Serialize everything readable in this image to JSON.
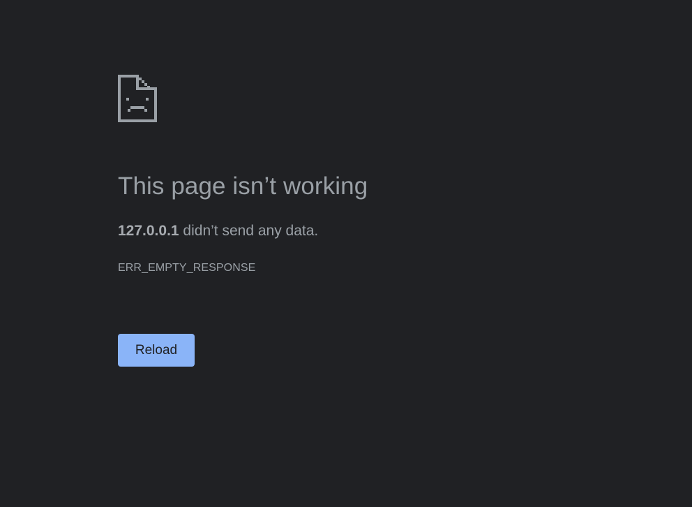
{
  "error_page": {
    "icon": "sad-file-icon",
    "heading": "This page isn’t working",
    "summary": {
      "host": "127.0.0.1",
      "message": " didn’t send any data."
    },
    "error_code": "ERR_EMPTY_RESPONSE",
    "reload_label": "Reload"
  },
  "colors": {
    "background": "#202124",
    "text": "#9aa0a6",
    "button": "#8ab4f8",
    "button_text": "#202124"
  }
}
